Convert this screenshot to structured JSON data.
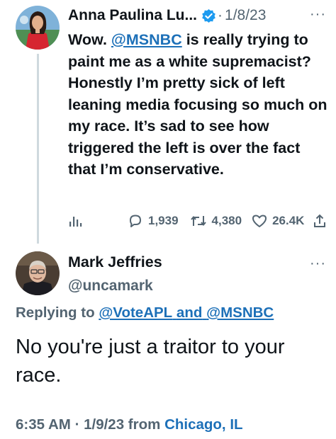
{
  "tweet1": {
    "name": "Anna Paulina Lu...",
    "separator": "·",
    "date": "1/8/23",
    "more": "···",
    "body": {
      "intro": "Wow.",
      "mention": "@MSNBC",
      "rest": "is really trying to paint me as a white supremacist? Honestly I’m pretty sick of left leaning media focusing so much on my race. It’s sad to see how triggered the left is over the fact that I’m conservative."
    },
    "actions": {
      "replies": "1,939",
      "retweets": "4,380",
      "likes": "26.4K"
    }
  },
  "tweet2": {
    "name": "Mark Jeffries",
    "handle": "@uncamark",
    "more": "···",
    "replying_prefix": "Replying to",
    "replying_to_1": "@VoteAPL",
    "replying_and": "and",
    "replying_to_2": "@MSNBC",
    "body": "No you're just a traitor to your race.",
    "time": "6:35 AM",
    "meta_sep": "·",
    "date": "1/9/23",
    "from": "from",
    "location": "Chicago, IL"
  },
  "icons": {
    "verified": "verified-badge-icon",
    "views": "analytics-icon",
    "reply": "reply-bubble-icon",
    "retweet": "retweet-icon",
    "like": "heart-icon",
    "share": "share-icon"
  },
  "colors": {
    "link": "#1d70b8",
    "muted": "#536471",
    "text": "#0f1419",
    "verified": "#1d9bf0"
  }
}
